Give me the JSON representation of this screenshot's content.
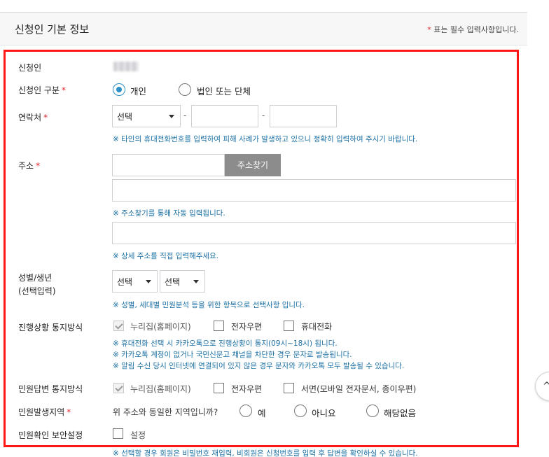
{
  "header": {
    "title": "신청인 기본 정보",
    "required_mark": "*",
    "required_note": "표는 필수 입력사항입니다."
  },
  "required_mark": "*",
  "applicant": {
    "label": "신청인"
  },
  "applicant_type": {
    "label": "신청인 구분",
    "options": [
      "개인",
      "법인 또는 단체"
    ],
    "selected": "개인"
  },
  "contact": {
    "label": "연락처",
    "select_value": "선택",
    "separator": "-",
    "notice": "※ 타인의 휴대전화번호를 입력하여 피해 사례가 발생하고 있으니 정확히 입력하여 주시기 바랍니다."
  },
  "address": {
    "label": "주소",
    "search_button": "주소찾기",
    "notice_auto": "※ 주소찾기를 통해 자동 입력됩니다.",
    "notice_detail": "※ 상세 주소를 직접 입력해주세요."
  },
  "gender_birth": {
    "label_line1": "성별/생년",
    "label_line2": "(선택입력)",
    "gender_value": "선택",
    "year_value": "선택",
    "notice": "※ 성별, 세대별 민원분석 등을 위한 항목으로 선택사항 입니다."
  },
  "progress_notify": {
    "label": "진행상황 통지방식",
    "options": [
      "누리집(홈페이지)",
      "전자우편",
      "휴대전화"
    ],
    "notices": [
      "※ 휴대전화 선택 시 카카오톡으로 진행상황이 통지(09시~18시) 됩니다.",
      "※ 카카오톡 계정이 없거나 국민신문고 채널을 차단한 경우 문자로 발송됩니다.",
      "※ 알림 수신 당시 인터넷에 연결되어 있지 않은 경우 문자와 카카오톡 모두 발송될 수 있습니다."
    ]
  },
  "answer_notify": {
    "label": "민원답변 통지방식",
    "options": [
      "누리집(홈페이지)",
      "전자우편",
      "서면(모바일 전자문서, 종이우편)"
    ]
  },
  "region": {
    "label": "민원발생지역",
    "question": "위 주소와 동일한 지역입니까?",
    "options": [
      "예",
      "아니요",
      "해당없음"
    ]
  },
  "security": {
    "label": "민원확인 보안설정",
    "option": "설정",
    "notice": "※ 선택할 경우 회원은 비밀번호 재입력, 비회원은 신청번호를 입력 후 답변을 확인하실 수 있습니다."
  },
  "scroll_top_icon": "chevron-up-icon",
  "colors": {
    "accent": "#2f8fc8",
    "required": "#e0262b",
    "notice": "#1a6fa3",
    "highlight_border": "#ff1616",
    "button_gray": "#8c8c8c"
  }
}
